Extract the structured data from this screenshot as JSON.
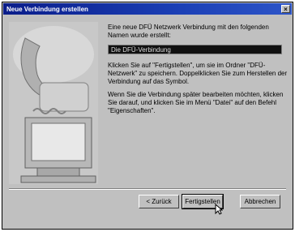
{
  "window": {
    "title": "Neue Verbindung erstellen",
    "close_glyph": "×"
  },
  "content": {
    "intro": "Eine neue DFÜ Netzwerk Verbindung mit den folgenden Namen wurde erstellt:",
    "connection_name": "Die DFÜ-Verbindung",
    "para1": "Klicken Sie auf \"Fertigstellen\", um sie im Ordner \"DFÜ-Netzwerk\" zu speichern. Doppelklicken Sie zum Herstellen der Verbindung auf das Symbol.",
    "para2": "Wenn Sie die Verbindung später bearbeiten möchten, klicken Sie darauf, und klicken Sie im Menü \"Datei\" auf den Befehl \"Eigenschaften\"."
  },
  "buttons": {
    "back": "< Zurück",
    "finish": "Fertigstellen",
    "cancel": "Abbrechen"
  },
  "colors": {
    "titlebar": "#0a1d8a",
    "dialog": "#c0c0c0"
  }
}
